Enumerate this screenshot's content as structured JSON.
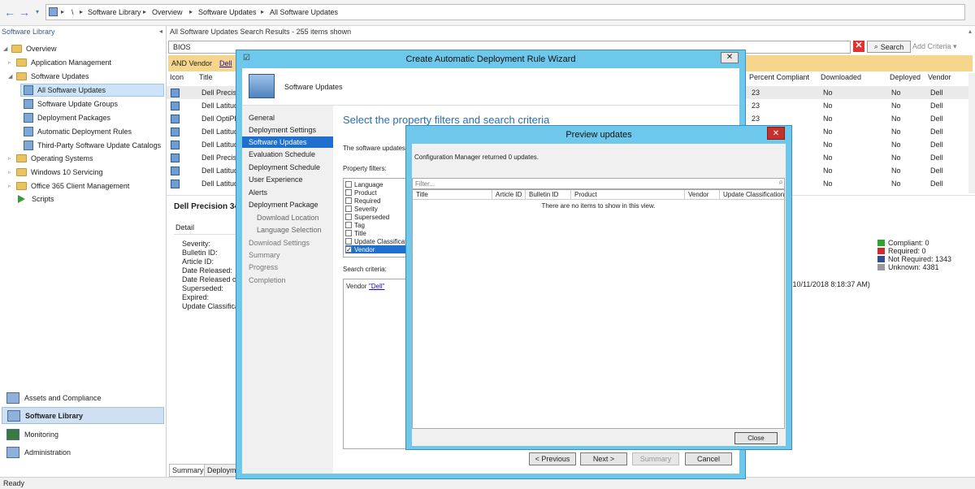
{
  "breadcrumb": [
    "\\",
    "Software Library",
    "Overview",
    "Software Updates",
    "All Software Updates"
  ],
  "left": {
    "title": "Software Library",
    "tree": [
      {
        "label": "Overview",
        "level": 0
      },
      {
        "label": "Application Management",
        "level": 1
      },
      {
        "label": "Software Updates",
        "level": 1
      },
      {
        "label": "All Software Updates",
        "level": 2
      },
      {
        "label": "Software Update Groups",
        "level": 2
      },
      {
        "label": "Deployment Packages",
        "level": 2
      },
      {
        "label": "Automatic Deployment Rules",
        "level": 2
      },
      {
        "label": "Third-Party Software Update Catalogs",
        "level": 2
      },
      {
        "label": "Operating Systems",
        "level": 1
      },
      {
        "label": "Windows 10 Servicing",
        "level": 1
      },
      {
        "label": "Office 365 Client Management",
        "level": 1
      },
      {
        "label": "Scripts",
        "level": 1
      }
    ],
    "workspaces": [
      "Assets and Compliance",
      "Software Library",
      "Monitoring",
      "Administration"
    ]
  },
  "main": {
    "results_title": "All Software Updates Search Results",
    "items_shown": "255 items shown",
    "search_value": "BIOS",
    "search_button": "Search",
    "add_criteria": "Add Criteria",
    "criteria_text": "AND Vendor",
    "criteria_value": "Dell",
    "columns_left": [
      "Icon",
      "Title"
    ],
    "columns_right": [
      "Percent Compliant",
      "Downloaded",
      "Deployed",
      "Vendor"
    ],
    "rows": [
      {
        "title": "Dell Precisio",
        "pct": "23",
        "downloaded": "No",
        "deployed": "No",
        "vendor": "Dell"
      },
      {
        "title": "Dell Latitud",
        "pct": "23",
        "downloaded": "No",
        "deployed": "No",
        "vendor": "Dell"
      },
      {
        "title": "Dell OptiPle",
        "pct": "23",
        "downloaded": "No",
        "deployed": "No",
        "vendor": "Dell"
      },
      {
        "title": "Dell Latitud",
        "pct": "23",
        "downloaded": "No",
        "deployed": "No",
        "vendor": "Dell"
      },
      {
        "title": "Dell Latitud",
        "pct": "23",
        "downloaded": "No",
        "deployed": "No",
        "vendor": "Dell"
      },
      {
        "title": "Dell Precisio",
        "pct": "23",
        "downloaded": "No",
        "deployed": "No",
        "vendor": "Dell"
      },
      {
        "title": "Dell Latitud",
        "pct": "23",
        "downloaded": "No",
        "deployed": "No",
        "vendor": "Dell"
      },
      {
        "title": "Dell Latitud",
        "pct": "23",
        "downloaded": "No",
        "deployed": "No",
        "vendor": "Dell"
      }
    ],
    "detail": {
      "title": "Dell Precision 34",
      "detail_tab": "Detail",
      "labels": [
        "Severity:",
        "Bulletin ID:",
        "Article ID:",
        "Date Released:",
        "Date Released or",
        "Superseded:",
        "Expired:",
        "Update Classificati"
      ],
      "date_fragment": "te: 10/11/2018 8:18:37 AM)",
      "legend": [
        {
          "label": "Compliant: 0",
          "color": "#2ea52e"
        },
        {
          "label": "Required: 0",
          "color": "#d12b2b"
        },
        {
          "label": "Not Required: 1343",
          "color": "#2f4f8f"
        },
        {
          "label": "Unknown: 4381",
          "color": "#9a9a9a"
        }
      ],
      "tabs": [
        "Summary",
        "Deployme"
      ]
    }
  },
  "status": "Ready",
  "wizard": {
    "title": "Create Automatic Deployment Rule Wizard",
    "banner": "Software Updates",
    "nav": [
      {
        "label": "General",
        "state": "normal"
      },
      {
        "label": "Deployment Settings",
        "state": "normal"
      },
      {
        "label": "Software Updates",
        "state": "selected"
      },
      {
        "label": "Evaluation Schedule",
        "state": "normal"
      },
      {
        "label": "Deployment Schedule",
        "state": "normal"
      },
      {
        "label": "User Experience",
        "state": "normal"
      },
      {
        "label": "Alerts",
        "state": "normal"
      },
      {
        "label": "Deployment Package",
        "state": "normal"
      },
      {
        "label": "Download Location",
        "state": "sub"
      },
      {
        "label": "Language Selection",
        "state": "sub"
      },
      {
        "label": "Download Settings",
        "state": "disabled"
      },
      {
        "label": "Summary",
        "state": "disabled"
      },
      {
        "label": "Progress",
        "state": "disabled"
      },
      {
        "label": "Completion",
        "state": "disabled"
      }
    ],
    "heading": "Select the property filters and search criteria",
    "intro": "The software updates th",
    "property_filters_label": "Property filters:",
    "filters": [
      {
        "label": "Language",
        "checked": false
      },
      {
        "label": "Product",
        "checked": false
      },
      {
        "label": "Required",
        "checked": false
      },
      {
        "label": "Severity",
        "checked": false
      },
      {
        "label": "Superseded",
        "checked": false
      },
      {
        "label": "Tag",
        "checked": false
      },
      {
        "label": "Title",
        "checked": false
      },
      {
        "label": "Update Classification",
        "checked": false
      },
      {
        "label": "Vendor",
        "checked": true
      }
    ],
    "search_criteria_label": "Search criteria:",
    "criteria_prefix": "Vendor",
    "criteria_value": "\"Dell\"",
    "buttons": {
      "previous": "< Previous",
      "next": "Next >",
      "summary": "Summary",
      "cancel": "Cancel"
    }
  },
  "preview": {
    "title": "Preview updates",
    "message": "Configuration Manager returned 0 updates.",
    "filter_placeholder": "Filter...",
    "columns": [
      "Title",
      "Article ID",
      "Bulletin ID",
      "Product",
      "Vendor",
      "Update Classification"
    ],
    "empty": "There are no items to show in this view.",
    "close_button": "Close"
  }
}
